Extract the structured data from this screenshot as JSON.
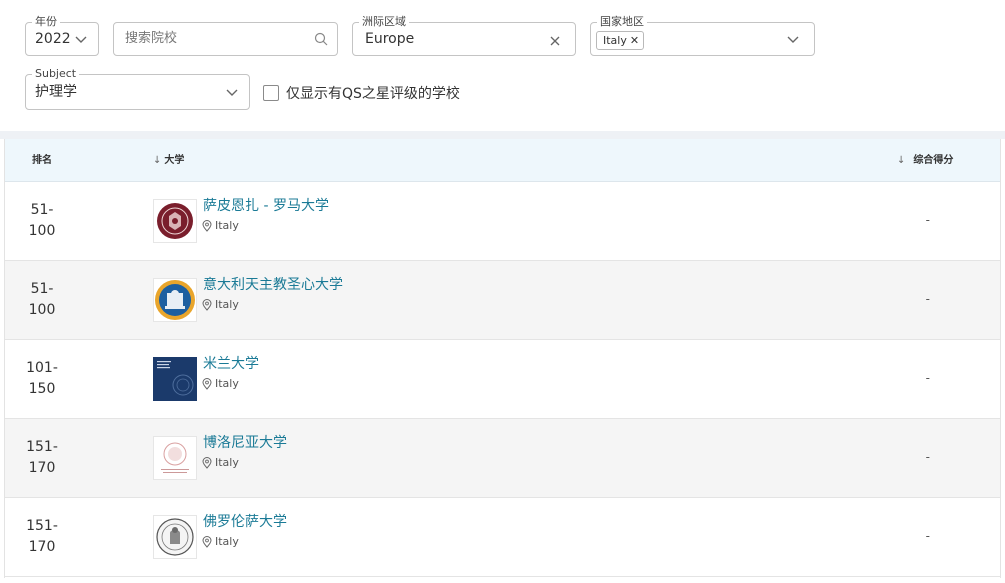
{
  "filters": {
    "year": {
      "legend": "年份",
      "value": "2022"
    },
    "search": {
      "placeholder": "搜索院校"
    },
    "region": {
      "legend": "洲际区域",
      "value": "Europe"
    },
    "country": {
      "legend": "国家地区",
      "chip": "Italy"
    },
    "subject": {
      "legend": "Subject",
      "value": "护理学"
    },
    "qs_stars_label": "仅显示有QS之星评级的学校"
  },
  "table": {
    "headers": {
      "rank": "排名",
      "university": "大学",
      "score": "综合得分"
    },
    "rows": [
      {
        "rank": "51-\n100",
        "name": "萨皮恩扎 - 罗马大学",
        "location": "Italy",
        "score": "-",
        "logo": "sapienza-seal"
      },
      {
        "rank": "51-\n100",
        "name": "意大利天主教圣心大学",
        "location": "Italy",
        "score": "-",
        "logo": "cattolica-seal"
      },
      {
        "rank": "101-\n150",
        "name": "米兰大学",
        "location": "Italy",
        "score": "-",
        "logo": "milano-logo"
      },
      {
        "rank": "151-\n170",
        "name": "博洛尼亚大学",
        "location": "Italy",
        "score": "-",
        "logo": "bologna-seal"
      },
      {
        "rank": "151-\n170",
        "name": "佛罗伦萨大学",
        "location": "Italy",
        "score": "-",
        "logo": "firenze-seal"
      }
    ]
  },
  "colors": {
    "link": "#1a7a96",
    "header_bg": "#eef7fc",
    "alt_row": "#f5f5f5"
  }
}
